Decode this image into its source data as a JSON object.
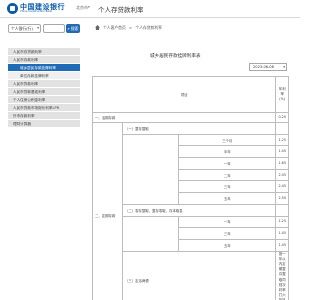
{
  "header": {
    "logo_cn": "中国建设银行",
    "logo_en": "China Construction Bank",
    "region": "北京市",
    "page_title": "个人存贷款利率"
  },
  "search": {
    "select_label": "个人银行(行)",
    "button_label": "搜索"
  },
  "breadcrumb": [
    "个人客户首页",
    "个人存贷款利率"
  ],
  "sidebar": {
    "items": [
      {
        "label": "人民币存贷款利率",
        "level": "top",
        "active": false
      },
      {
        "label": "人民币存款利率",
        "level": "top",
        "active": false
      },
      {
        "label": "城乡居民存款挂牌利率",
        "level": "sub",
        "active": true
      },
      {
        "label": "单位存款挂牌利率",
        "level": "sub",
        "active": false
      },
      {
        "label": "人民币贷款利率",
        "level": "top",
        "active": false
      },
      {
        "label": "人民币贷款基准利率",
        "level": "top",
        "active": false
      },
      {
        "label": "个人住房公积金利率",
        "level": "top",
        "active": false
      },
      {
        "label": "人民币贷款市场报价利率LPR",
        "level": "top",
        "active": false
      },
      {
        "label": "外币存款利率",
        "level": "top",
        "active": false
      },
      {
        "label": "理财计算器",
        "level": "top",
        "active": false
      }
    ]
  },
  "main": {
    "title": "城乡居民存款挂牌利率表",
    "date": "2023-06-08",
    "table": {
      "header_item": "项目",
      "header_rate": "年利率(%)",
      "huoqi_label": "一、活期存款",
      "huoqi_rate": "0.20",
      "dingqi_label": "二、定期存款",
      "section_1_label": "（一）整存整取",
      "section_2_label": "（二）零存整取、整存零取、存本取息",
      "section_3_label": "（三）定活两便",
      "rows_1": [
        {
          "term": "三个月",
          "rate": "1.25"
        },
        {
          "term": "半年",
          "rate": "1.45"
        },
        {
          "term": "一年",
          "rate": "1.65"
        },
        {
          "term": "二年",
          "rate": "2.05"
        },
        {
          "term": "三年",
          "rate": "2.45"
        },
        {
          "term": "五年",
          "rate": "2.50"
        }
      ],
      "rows_2": [
        {
          "term": "一年",
          "rate": "1.25"
        },
        {
          "term": "三年",
          "rate": "1.45"
        },
        {
          "term": "五年",
          "rate": "1.45"
        }
      ],
      "dinghuo_rate": "按一年以内定期整存整取同档次利率打六折执行"
    }
  }
}
